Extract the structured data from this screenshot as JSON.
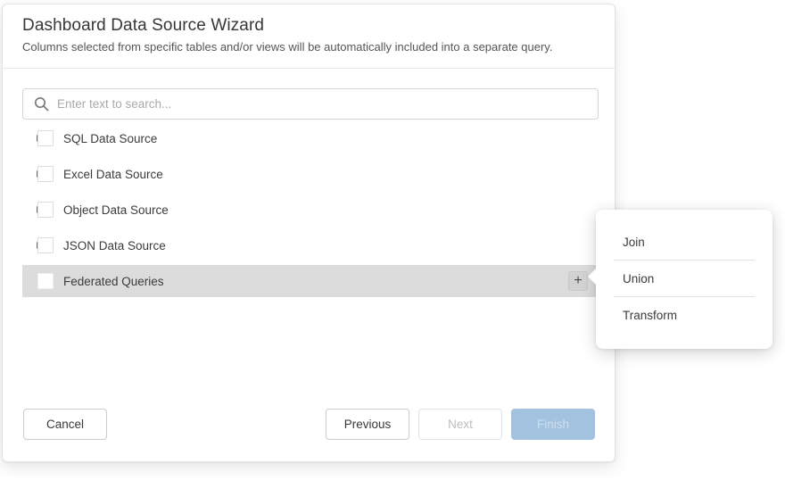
{
  "dialog": {
    "title": "Dashboard Data Source Wizard",
    "subtitle": "Columns selected from specific tables and/or views will be automatically included into a separate query."
  },
  "search": {
    "placeholder": "Enter text to search...",
    "value": "",
    "icon": "search-icon"
  },
  "tree": {
    "items": [
      {
        "label": "SQL Data Source",
        "expandable": true,
        "checked": false,
        "selected": false
      },
      {
        "label": "Excel Data Source",
        "expandable": true,
        "checked": false,
        "selected": false
      },
      {
        "label": "Object Data Source",
        "expandable": true,
        "checked": false,
        "selected": false
      },
      {
        "label": "JSON Data Source",
        "expandable": true,
        "checked": false,
        "selected": false
      },
      {
        "label": "Federated Queries",
        "expandable": false,
        "checked": false,
        "selected": true,
        "action_icon": "plus-icon"
      }
    ]
  },
  "icons": {
    "plus_glyph": "+"
  },
  "context_menu": {
    "items": [
      {
        "label": "Join"
      },
      {
        "label": "Union"
      },
      {
        "label": "Transform"
      }
    ]
  },
  "footer": {
    "cancel_label": "Cancel",
    "previous_label": "Previous",
    "next_label": "Next",
    "finish_label": "Finish",
    "next_enabled": false,
    "finish_enabled": false
  },
  "colors": {
    "selected_row": "#dcdcdc",
    "finish_button_bg": "#a2c2df",
    "finish_button_text": "#cfdfee",
    "border": "#d5d5d5",
    "divider": "#e8e8e8"
  }
}
